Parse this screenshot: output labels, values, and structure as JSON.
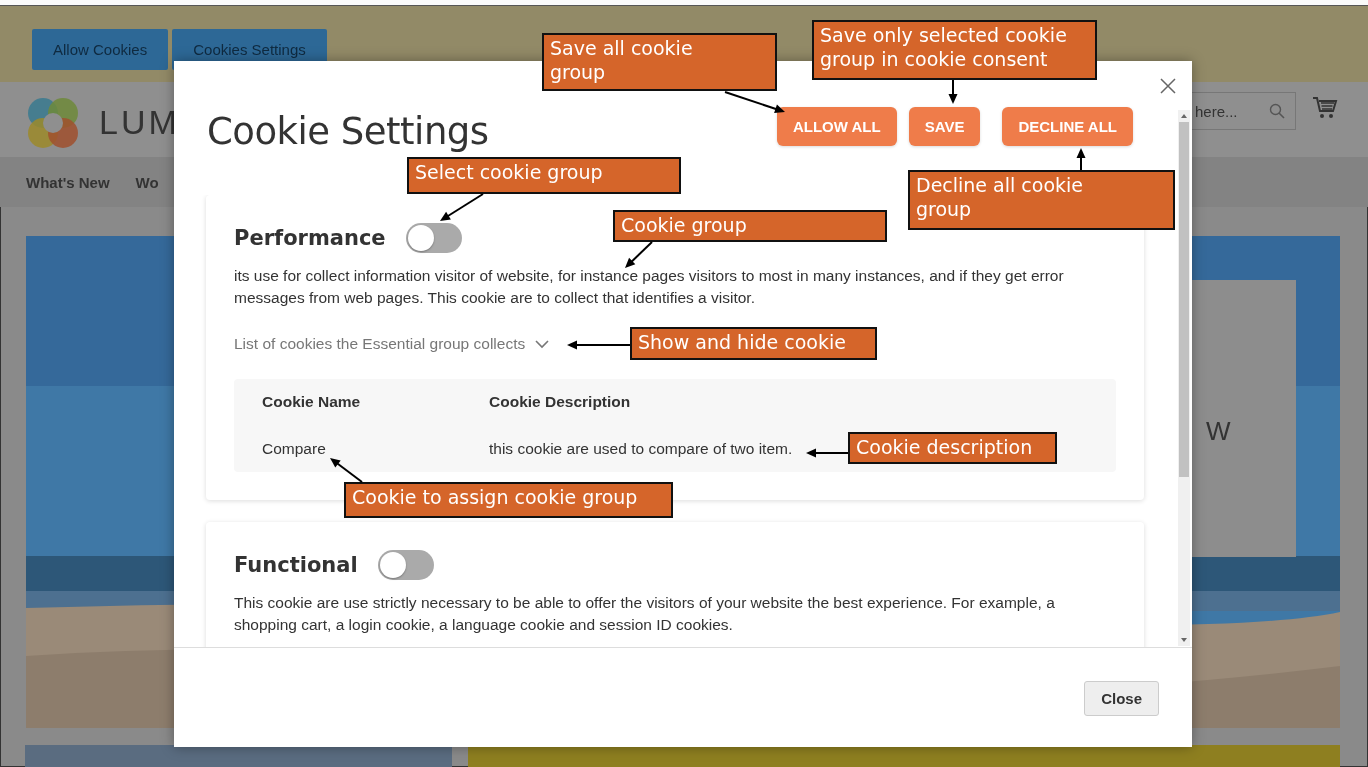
{
  "cookie_bar": {
    "buttons": [
      "Allow Cookies",
      "Cookies Settings"
    ]
  },
  "header": {
    "logo_text": "LUM",
    "search": {
      "value": "here..."
    }
  },
  "nav": {
    "items": [
      "What's New",
      "Wo"
    ]
  },
  "hero": {
    "text": "W"
  },
  "modal": {
    "title": "Cookie Settings",
    "buttons": [
      "ALLOW ALL",
      "SAVE",
      "DECLINE ALL"
    ],
    "groups": [
      {
        "name": "Performance",
        "enabled": false,
        "description": "its use for collect information visitor of website, for instance pages visitors to most in many instances, and if they get error messages from web pages. This cookie are to collect that identifies a visitor.",
        "list_label": "List of cookies the Essential group collects",
        "expanded": true,
        "table": {
          "columns": [
            "Cookie Name",
            "Cookie Description"
          ],
          "rows": [
            [
              "Compare",
              "this cookie are used to compare of two item."
            ]
          ]
        }
      },
      {
        "name": "Functional",
        "enabled": false,
        "description": "This cookie are use strictly necessary to be able to offer the visitors of your website the best experience. For example, a shopping cart, a login cookie, a language cookie and session ID cookies."
      }
    ],
    "close_button": "Close"
  },
  "annotations": [
    {
      "text": "Save all cookie group"
    },
    {
      "text": "Save only selected cookie group in cookie consent"
    },
    {
      "text": "Select cookie group"
    },
    {
      "text": "Cookie group"
    },
    {
      "text": "Decline all cookie group"
    },
    {
      "text": "Show and hide cookie"
    },
    {
      "text": "Cookie description"
    },
    {
      "text": "Cookie to assign cookie group"
    }
  ]
}
